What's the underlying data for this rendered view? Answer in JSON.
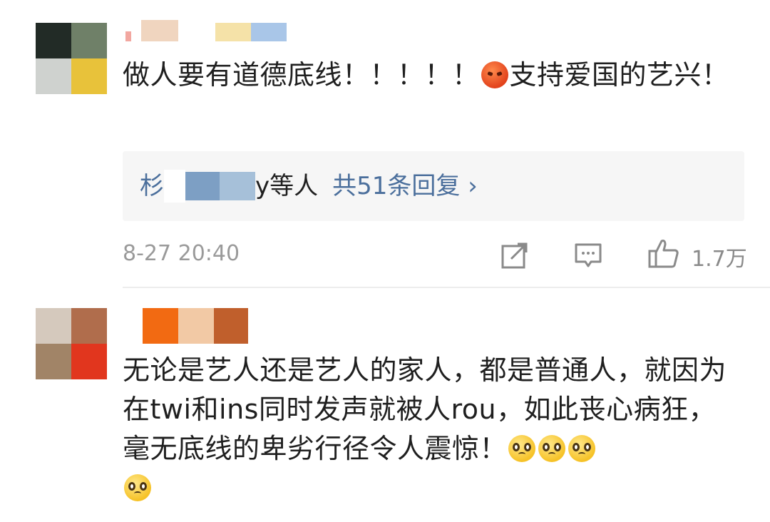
{
  "comments": [
    {
      "text_part1": "做人要有道德底线！！！！！",
      "text_part2": "支持爱国的艺兴！",
      "emoji_after_part1": "angry-face-icon",
      "reply": {
        "prefix": "杉",
        "suffix": "y等人",
        "link": "共51条回复 ›"
      },
      "timestamp": "8-27 20:40",
      "likes": "1.7万",
      "avatar_colors": [
        "#222b26",
        "#6f8068",
        "#cfd2cf",
        "#e8c23a"
      ],
      "name_colors": [
        "#f0d5bf",
        "#f5e2a8",
        "#a9c6e8"
      ]
    },
    {
      "text": "无论是艺人还是艺人的家人，都是普通人，就因为在twi和ins同时发声就被人rou，如此丧心病狂，毫无底线的卑劣行径令人震惊！",
      "emojis": [
        "pleading-face-icon",
        "pleading-face-icon",
        "pleading-face-icon",
        "pleading-face-icon"
      ],
      "avatar_colors": [
        "#d5c9bd",
        "#b06d4c",
        "#a18467",
        "#e1361e"
      ],
      "name_colors": [
        "#f26a12",
        "#f2c9a5",
        "#c05f2c"
      ]
    }
  ],
  "icons": {
    "share": "share-icon",
    "comment": "comment-icon",
    "like": "thumbs-up-icon"
  }
}
